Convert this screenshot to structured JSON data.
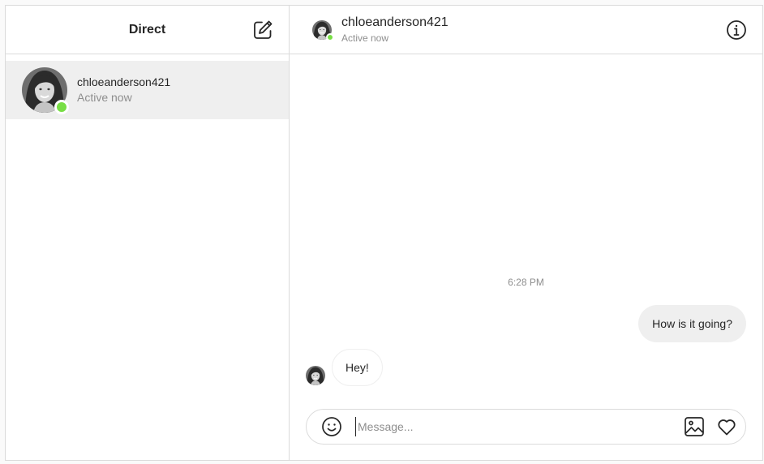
{
  "sidebar": {
    "title": "Direct",
    "compose_icon": "new-message-icon",
    "threads": [
      {
        "username": "chloeanderson421",
        "status": "Active now",
        "online": true
      }
    ]
  },
  "chat": {
    "header": {
      "username": "chloeanderson421",
      "status": "Active now",
      "info_icon": "info-icon"
    },
    "timestamp": "6:28 PM",
    "messages": [
      {
        "direction": "outgoing",
        "text": "How is it going?"
      },
      {
        "direction": "incoming",
        "text": "Hey!"
      }
    ],
    "composer": {
      "placeholder": "Message...",
      "value": "",
      "icons": [
        "emoji-icon",
        "image-icon",
        "heart-icon"
      ]
    }
  },
  "colors": {
    "online": "#78de45",
    "border": "#dbdbdb",
    "selected_thread": "#efefef",
    "bubble": "#efefef",
    "secondary_text": "#8e8e8e",
    "primary_text": "#262626"
  }
}
